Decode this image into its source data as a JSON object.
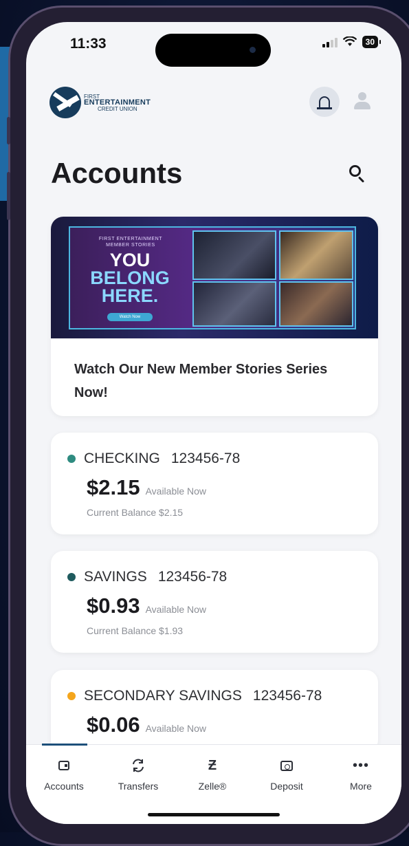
{
  "status_bar": {
    "time": "11:33",
    "battery": "30"
  },
  "header": {
    "logo_top": "FIRST",
    "logo_main": "ENTERTAINMENT",
    "logo_sub": "CREDIT UNION"
  },
  "page": {
    "title": "Accounts"
  },
  "promo": {
    "kicker": "FIRST ENTERTAINMENT MEMBER STORIES",
    "headline_1": "YOU",
    "headline_2": "BELONG",
    "headline_3": "HERE.",
    "button": "Watch Now",
    "text": "Watch Our New Member Stories Series Now!"
  },
  "accounts": [
    {
      "name": "CHECKING",
      "number": "123456-78",
      "amount": "$2.15",
      "available": "Available Now",
      "current": "Current Balance $2.15",
      "dot_color": "#2e8b80"
    },
    {
      "name": "SAVINGS",
      "number": "123456-78",
      "amount": "$0.93",
      "available": "Available Now",
      "current": "Current Balance $1.93",
      "dot_color": "#1f5b5e"
    },
    {
      "name": "SECONDARY SAVINGS",
      "number": "123456-78",
      "amount": "$0.06",
      "available": "Available Now",
      "current": "",
      "dot_color": "#f4a51c"
    }
  ],
  "tabs": [
    {
      "label": "Accounts",
      "icon": "wallet-icon"
    },
    {
      "label": "Transfers",
      "icon": "transfers-icon"
    },
    {
      "label": "Zelle®",
      "icon": "zelle-icon"
    },
    {
      "label": "Deposit",
      "icon": "camera-icon"
    },
    {
      "label": "More",
      "icon": "more-icon"
    }
  ],
  "colors": {
    "accent": "#1d4f7a",
    "brand": "#173c5c"
  }
}
